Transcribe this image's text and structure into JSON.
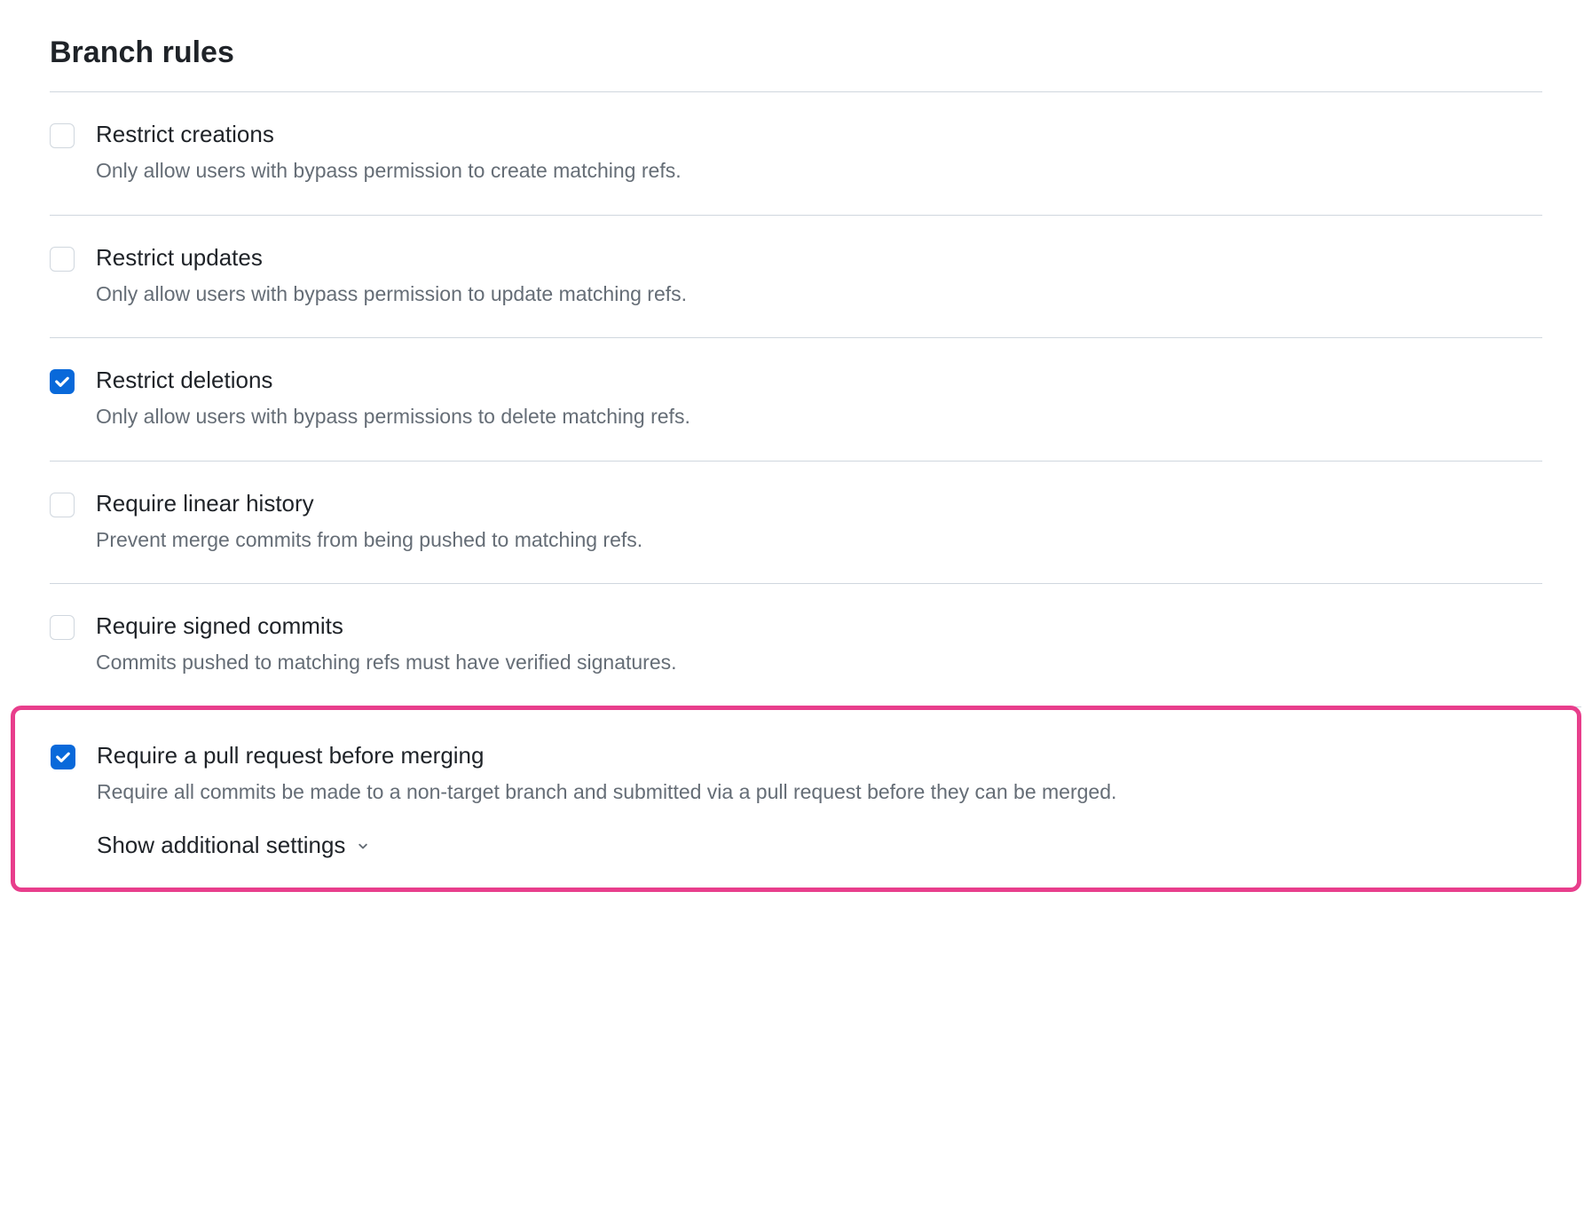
{
  "section": {
    "title": "Branch rules"
  },
  "rules": [
    {
      "label": "Restrict creations",
      "description": "Only allow users with bypass permission to create matching refs.",
      "checked": false
    },
    {
      "label": "Restrict updates",
      "description": "Only allow users with bypass permission to update matching refs.",
      "checked": false
    },
    {
      "label": "Restrict deletions",
      "description": "Only allow users with bypass permissions to delete matching refs.",
      "checked": true
    },
    {
      "label": "Require linear history",
      "description": "Prevent merge commits from being pushed to matching refs.",
      "checked": false
    },
    {
      "label": "Require signed commits",
      "description": "Commits pushed to matching refs must have verified signatures.",
      "checked": false
    },
    {
      "label": "Require a pull request before merging",
      "description": "Require all commits be made to a non-target branch and submitted via a pull request before they can be merged.",
      "checked": true,
      "show_additional": "Show additional settings"
    }
  ]
}
